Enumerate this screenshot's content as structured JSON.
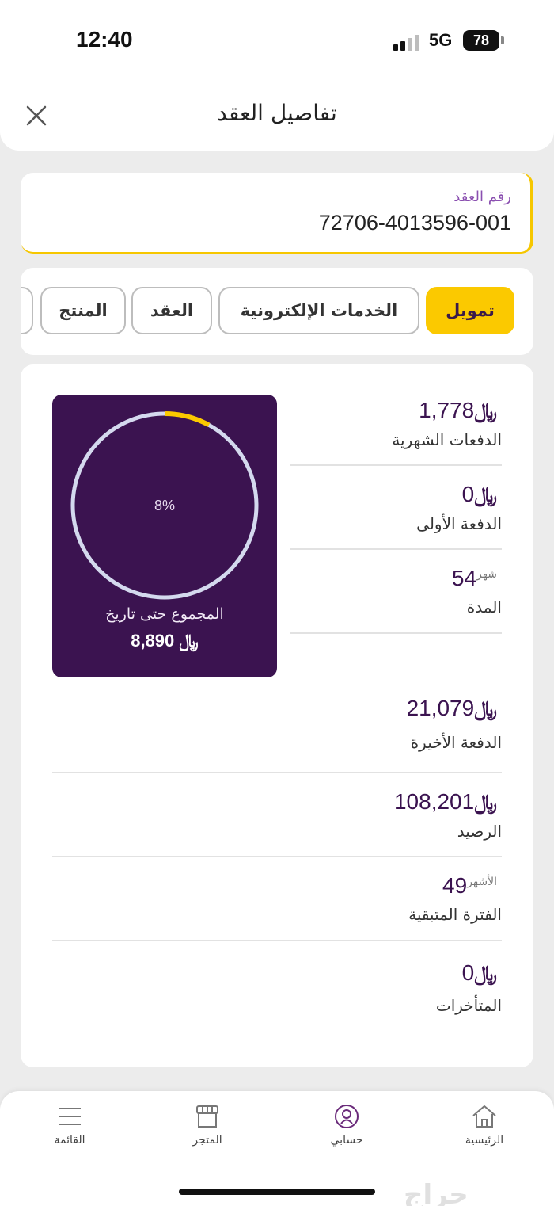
{
  "status_bar": {
    "time": "12:40",
    "network": "5G",
    "battery": "78"
  },
  "header": {
    "title": "تفاصيل العقد"
  },
  "contract": {
    "label": "رقم العقد",
    "number": "72706-4013596-001"
  },
  "tabs": [
    {
      "label": "تمويل",
      "active": true
    },
    {
      "label": "الخدمات الإلكترونية",
      "active": false
    },
    {
      "label": "العقد",
      "active": false
    },
    {
      "label": "المنتج",
      "active": false
    }
  ],
  "currency_symbol": "﷼",
  "summary": {
    "progress_percent_label": "8%",
    "progress_fraction": 0.08,
    "caption": "المجموع حتى تاريخ",
    "amount": "8,890",
    "colors": {
      "box": "#3b1350",
      "ring": "#d4d9ee",
      "progress": "#fbc900"
    }
  },
  "details": [
    {
      "value": "1,778",
      "label": "الدفعات الشهرية",
      "currency": true
    },
    {
      "value": "0",
      "label": "الدفعة الأولى",
      "currency": true
    },
    {
      "value": "54",
      "unit": "شهر",
      "label": "المدة",
      "currency": false
    },
    {
      "value": "21,079",
      "label": "الدفعة الأخيرة",
      "currency": true
    },
    {
      "value": "108,201",
      "label": "الرصيد",
      "currency": true
    },
    {
      "value": "49",
      "unit": "الأشهر",
      "label": "الفترة المتبقية",
      "currency": false
    },
    {
      "value": "0",
      "label": "المتأخرات",
      "currency": true
    }
  ],
  "bottom_nav": [
    {
      "label": "الرئيسية",
      "icon": "home-icon"
    },
    {
      "label": "حسابي",
      "icon": "account-icon"
    },
    {
      "label": "المتجر",
      "icon": "store-icon"
    },
    {
      "label": "القائمة",
      "icon": "menu-icon"
    }
  ],
  "watermark": "حراج",
  "colors": {
    "accent": "#fbc900",
    "brand": "#3b1350"
  }
}
